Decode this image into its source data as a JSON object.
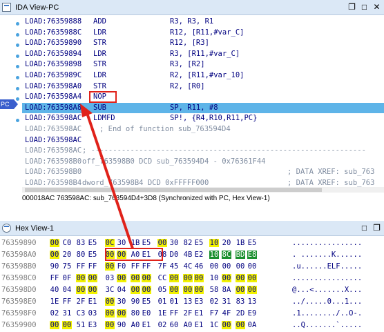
{
  "ida_view": {
    "title": "IDA View-PC",
    "pc_label": "PC",
    "lines": [
      {
        "addr": "LOAD:76359888",
        "mn": "ADD",
        "op": "R3, R3, R1",
        "cm": "",
        "style": "code"
      },
      {
        "addr": "LOAD:7635988C",
        "mn": "LDR",
        "op": "R12, [R11,#var_C]",
        "cm": "",
        "style": "code"
      },
      {
        "addr": "LOAD:76359890",
        "mn": "STR",
        "op": "R12, [R3]",
        "cm": "",
        "style": "code"
      },
      {
        "addr": "LOAD:76359894",
        "mn": "LDR",
        "op": "R3, [R11,#var_C]",
        "cm": "",
        "style": "code"
      },
      {
        "addr": "LOAD:76359898",
        "mn": "STR",
        "op": "R3, [R2]",
        "cm": "",
        "style": "code"
      },
      {
        "addr": "LOAD:7635989C",
        "mn": "LDR",
        "op": "R2, [R11,#var_10]",
        "cm": "",
        "style": "code"
      },
      {
        "addr": "LOAD:763598A0",
        "mn": "STR",
        "op": "R2, [R0]",
        "cm": "",
        "style": "code"
      },
      {
        "addr": "LOAD:763598A4",
        "mn": "NOP",
        "op": "",
        "cm": "",
        "style": "code"
      },
      {
        "addr": "LOAD:763598A8",
        "mn": "SUB",
        "op": "SP, R11, #8",
        "cm": "",
        "style": "highlight"
      },
      {
        "addr": "LOAD:763598AC",
        "mn": "LDMFD",
        "op": "SP!, {R4,R10,R11,PC}",
        "cm": "",
        "style": "code"
      },
      {
        "addr": "LOAD:763598AC",
        "mn": "; End of function sub_763594D4",
        "op": "",
        "cm": "",
        "style": "dim"
      },
      {
        "addr": "LOAD:763598AC",
        "mn": "",
        "op": "",
        "cm": "",
        "style": "code"
      },
      {
        "addr": "LOAD:763598AC",
        "mn": "; ---------------------------------------------------------------",
        "op": "",
        "cm": "",
        "style": "dim"
      },
      {
        "addr": "LOAD:763598B0",
        "mn": "off_763598B0 DCD sub_763594D4 - 0x76361F44",
        "op": "",
        "cm": "",
        "style": "dim"
      },
      {
        "addr": "LOAD:763598B0",
        "mn": "",
        "op": "",
        "cm": "; DATA XREF: sub_763",
        "style": "dim"
      },
      {
        "addr": "LOAD:763598B4",
        "mn": "dword_763598B4 DCD 0xFFFFF000",
        "op": "",
        "cm": "; DATA XREF: sub_763",
        "style": "dim"
      }
    ],
    "status": "000018AC 763598AC: sub_763594D4+3D8 (Synchronized with PC, Hex View-1)"
  },
  "hex_view": {
    "title": "Hex View-1",
    "rows": [
      {
        "addr": "76359890",
        "bytes": [
          "00",
          "C0",
          "83",
          "E5",
          "0C",
          "30",
          "1B",
          "E5",
          "00",
          "30",
          "82",
          "E5",
          "10",
          "20",
          "1B",
          "E5"
        ],
        "yellow": [
          0,
          4,
          8,
          12
        ],
        "ascii": "................"
      },
      {
        "addr": "763598A0",
        "bytes": [
          "00",
          "20",
          "80",
          "E5",
          "00",
          "00",
          "A0",
          "E1",
          "08",
          "D0",
          "4B",
          "E2",
          "10",
          "8C",
          "BD",
          "E8"
        ],
        "yellow": [
          0,
          4,
          5
        ],
        "green": [
          12,
          13,
          14,
          15
        ],
        "ascii": ". .......K......"
      },
      {
        "addr": "763598B0",
        "bytes": [
          "90",
          "75",
          "FF",
          "FF",
          "00",
          "F0",
          "FF",
          "FF",
          "7F",
          "45",
          "4C",
          "46",
          "00",
          "00",
          "00",
          "00"
        ],
        "yellow": [
          4
        ],
        "ascii": ".u......ELF....."
      },
      {
        "addr": "763598C0",
        "bytes": [
          "FF",
          "0F",
          "00",
          "00",
          "03",
          "00",
          "00",
          "00",
          "CC",
          "00",
          "00",
          "00",
          "10",
          "00",
          "00",
          "00"
        ],
        "yellow": [
          2,
          3,
          5,
          6,
          7,
          9,
          10,
          11,
          13,
          14,
          15
        ],
        "ascii": "................"
      },
      {
        "addr": "763598D0",
        "bytes": [
          "40",
          "04",
          "00",
          "00",
          "3C",
          "04",
          "00",
          "00",
          "05",
          "00",
          "00",
          "00",
          "58",
          "8A",
          "00",
          "00"
        ],
        "yellow": [
          2,
          3,
          6,
          7,
          9,
          10,
          11,
          14,
          15
        ],
        "ascii": "@...<.......X..."
      },
      {
        "addr": "763598E0",
        "bytes": [
          "1E",
          "FF",
          "2F",
          "E1",
          "00",
          "30",
          "90",
          "E5",
          "01",
          "01",
          "13",
          "E3",
          "02",
          "31",
          "83",
          "13"
        ],
        "yellow": [
          4
        ],
        "ascii": "../.....0...1..."
      },
      {
        "addr": "763598F0",
        "bytes": [
          "02",
          "31",
          "C3",
          "03",
          "00",
          "00",
          "80",
          "E0",
          "1E",
          "FF",
          "2F",
          "E1",
          "F7",
          "4F",
          "2D",
          "E9"
        ],
        "yellow": [
          4,
          5
        ],
        "ascii": ".1......../..O-."
      },
      {
        "addr": "76359900",
        "bytes": [
          "00",
          "00",
          "51",
          "E3",
          "00",
          "90",
          "A0",
          "E1",
          "02",
          "60",
          "A0",
          "E1",
          "1C",
          "00",
          "00",
          "0A"
        ],
        "yellow": [
          0,
          1,
          4,
          13,
          14
        ],
        "ascii": "..Q.......`....."
      }
    ]
  },
  "colors": {
    "highlight_row": "#5eb4e8",
    "annotation_red": "#e0221a",
    "byte_yellow": "#f2f200",
    "byte_green": "#1a8f2e"
  }
}
